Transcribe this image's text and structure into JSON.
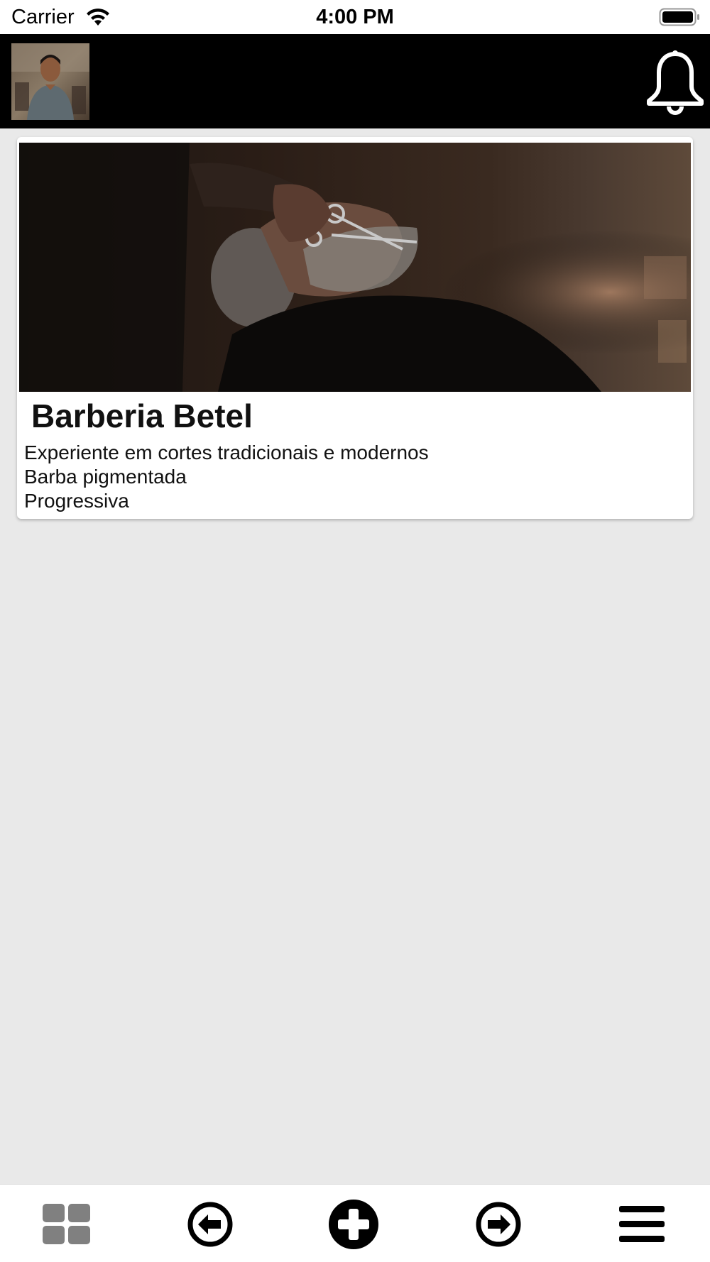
{
  "status_bar": {
    "carrier": "Carrier",
    "time": "4:00 PM",
    "icons": [
      "wifi-icon",
      "battery-icon"
    ]
  },
  "header": {
    "avatar_icon": "avatar",
    "notification_icon": "bell-icon",
    "background_color": "#000000"
  },
  "card": {
    "image_icon": "barber-photo",
    "title": "Barberia Betel",
    "lines": [
      "Experiente em cortes tradicionais e modernos",
      "Barba pigmentada",
      "Progressiva"
    ]
  },
  "bottom_nav": {
    "items": [
      "grid-icon",
      "arrow-left-circle-icon",
      "plus-circle-icon",
      "arrow-right-circle-icon",
      "menu-icon"
    ]
  },
  "colors": {
    "background": "#e9e9e9",
    "header": "#000000",
    "card": "#ffffff",
    "grid_icon": "#808080"
  }
}
